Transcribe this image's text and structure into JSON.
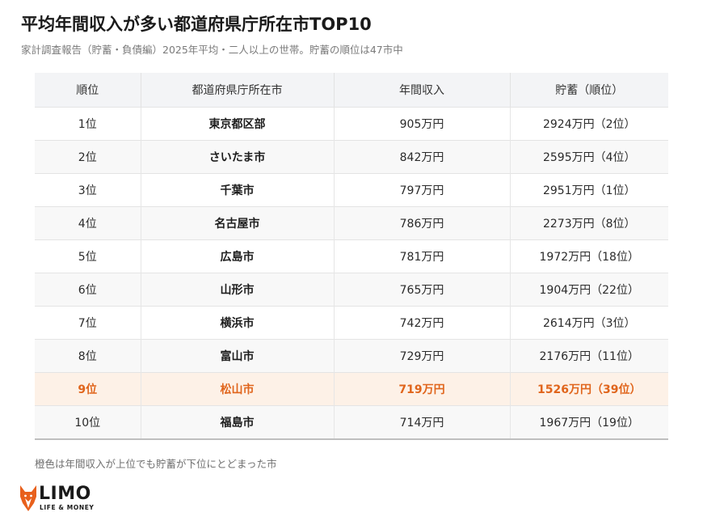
{
  "title": "平均年間収入が多い都道府県庁所在市TOP10",
  "subtitle": "家計調査報告（貯蓄・負債編）2025年平均・二人以上の世帯。貯蓄の順位は47市中",
  "table": {
    "headers": [
      "順位",
      "都道府県庁所在市",
      "年間収入",
      "貯蓄（順位）"
    ],
    "rows": [
      {
        "rank": "1位",
        "city": "東京都区部",
        "income": "905万円",
        "savings": "2924万円（2位）",
        "highlight": false
      },
      {
        "rank": "2位",
        "city": "さいたま市",
        "income": "842万円",
        "savings": "2595万円（4位）",
        "highlight": false
      },
      {
        "rank": "3位",
        "city": "千葉市",
        "income": "797万円",
        "savings": "2951万円（1位）",
        "highlight": false
      },
      {
        "rank": "4位",
        "city": "名古屋市",
        "income": "786万円",
        "savings": "2273万円（8位）",
        "highlight": false
      },
      {
        "rank": "5位",
        "city": "広島市",
        "income": "781万円",
        "savings": "1972万円（18位）",
        "highlight": false
      },
      {
        "rank": "6位",
        "city": "山形市",
        "income": "765万円",
        "savings": "1904万円（22位）",
        "highlight": false
      },
      {
        "rank": "7位",
        "city": "横浜市",
        "income": "742万円",
        "savings": "2614万円（3位）",
        "highlight": false
      },
      {
        "rank": "8位",
        "city": "富山市",
        "income": "729万円",
        "savings": "2176万円（11位）",
        "highlight": false
      },
      {
        "rank": "9位",
        "city": "松山市",
        "income": "719万円",
        "savings": "1526万円（39位）",
        "highlight": true
      },
      {
        "rank": "10位",
        "city": "福島市",
        "income": "714万円",
        "savings": "1967万円（19位）",
        "highlight": false
      }
    ]
  },
  "footnote": "橙色は年間収入が上位でも貯蓄が下位にとどまった市",
  "logo": {
    "name": "LIMO",
    "tagline": "LIFE & MONEY",
    "icon": "fox-icon"
  },
  "colors": {
    "highlight_text": "#e0651c",
    "highlight_bg": "#fdf1e7",
    "logo_orange": "#e8601c",
    "header_bg": "#f3f4f6"
  }
}
